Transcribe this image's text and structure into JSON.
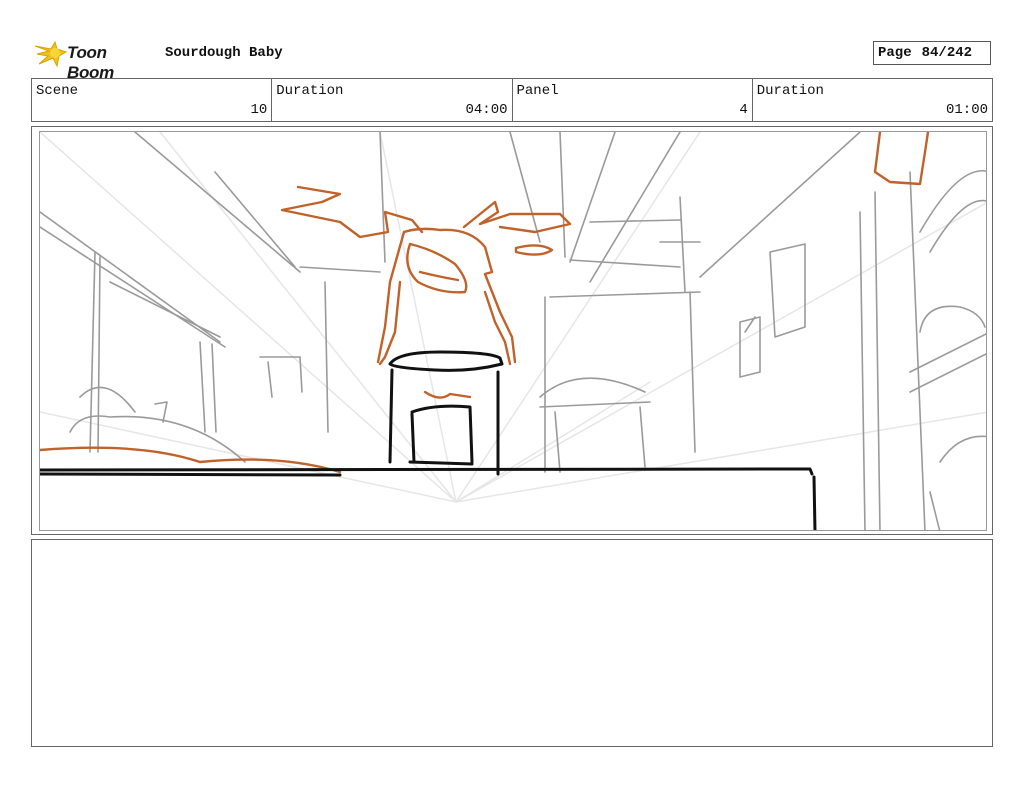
{
  "header": {
    "logo_text": "Toon Boom",
    "project_title": "Sourdough Baby",
    "page_label": "Page",
    "page_value": "84/242"
  },
  "info": {
    "scene_label": "Scene",
    "scene_value": "10",
    "duration_label": "Duration",
    "duration_value": "04:00",
    "panel_label": "Panel",
    "panel_value": "4",
    "panel_duration_label": "Duration",
    "panel_duration_value": "01:00"
  },
  "colors": {
    "sketch_orange": "#c0622a",
    "sketch_gray": "#9a9a9a",
    "ink": "#111111",
    "logo_yellow": "#f2c21a"
  },
  "notes": {
    "text": ""
  }
}
